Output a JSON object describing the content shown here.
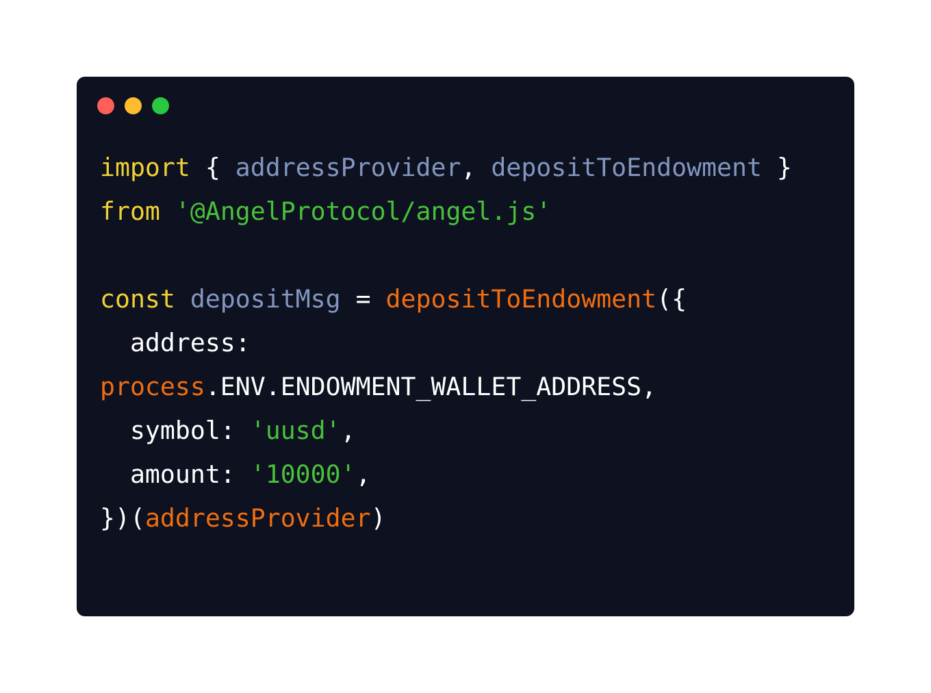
{
  "window": {
    "controls": [
      {
        "name": "close",
        "color": "#ff5f57"
      },
      {
        "name": "minimize",
        "color": "#febc2e"
      },
      {
        "name": "maximize",
        "color": "#28c840"
      }
    ]
  },
  "colors": {
    "background": "#0d1120",
    "keyword": "#f0d234",
    "identifier": "#8396bf",
    "string": "#49c13a",
    "function": "#f06d10",
    "plain": "#ffffff"
  },
  "code": {
    "line1": {
      "kw_import": "import",
      "brace_open": " { ",
      "id_address_provider": "addressProvider",
      "comma": ", ",
      "id_deposit_to_endowment": "depositToEndowment",
      "brace_close": " }"
    },
    "line2": {
      "kw_from": "from",
      "space": " ",
      "str_module": "'@AngelProtocol/angel.js'"
    },
    "line4": {
      "kw_const": "const",
      "space1": " ",
      "id_deposit_msg": "depositMsg",
      "equals": " = ",
      "fn_deposit_to_endowment": "depositToEndowment",
      "paren_brace": "({"
    },
    "line5": {
      "key_address": "  address:"
    },
    "line6": {
      "fn_process": "process",
      "rest": ".ENV.ENDOWMENT_WALLET_ADDRESS,"
    },
    "line7": {
      "key_symbol": "  symbol: ",
      "str_uusd": "'uusd'",
      "comma": ","
    },
    "line8": {
      "key_amount": "  amount: ",
      "str_amount": "'10000'",
      "comma": ","
    },
    "line9": {
      "close": "})(",
      "fn_address_provider": "addressProvider",
      "paren_close": ")"
    }
  }
}
